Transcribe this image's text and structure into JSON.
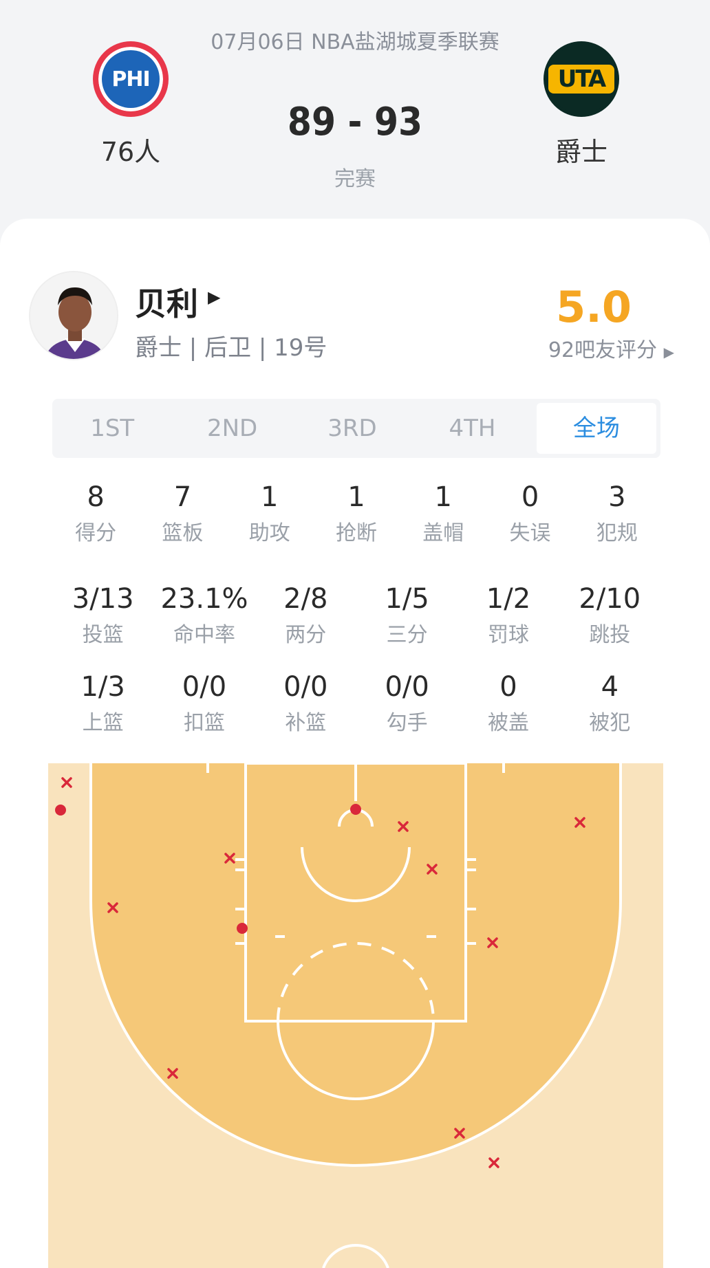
{
  "header": {
    "match_title": "07月06日 NBA盐湖城夏季联赛",
    "score": "89 - 93",
    "status": "完赛",
    "home_team": {
      "abbr": "PHI",
      "name": "76人"
    },
    "away_team": {
      "abbr": "UTA",
      "name": "爵士"
    }
  },
  "player": {
    "name": "贝利",
    "meta": "爵士 | 后卫 | 19号",
    "rating": "5.0",
    "rating_label": "92吧友评分"
  },
  "tabs": [
    "1ST",
    "2ND",
    "3RD",
    "4TH",
    "全场"
  ],
  "active_tab": "全场",
  "basic_stats": [
    {
      "value": "8",
      "label": "得分"
    },
    {
      "value": "7",
      "label": "篮板"
    },
    {
      "value": "1",
      "label": "助攻"
    },
    {
      "value": "1",
      "label": "抢断"
    },
    {
      "value": "1",
      "label": "盖帽"
    },
    {
      "value": "0",
      "label": "失误"
    },
    {
      "value": "3",
      "label": "犯规"
    }
  ],
  "shooting_stats": [
    {
      "value": "3/13",
      "label": "投篮"
    },
    {
      "value": "23.1%",
      "label": "命中率"
    },
    {
      "value": "2/8",
      "label": "两分"
    },
    {
      "value": "1/5",
      "label": "三分"
    },
    {
      "value": "1/2",
      "label": "罚球"
    },
    {
      "value": "2/10",
      "label": "跳投"
    },
    {
      "value": "1/3",
      "label": "上篮"
    },
    {
      "value": "0/0",
      "label": "扣篮"
    },
    {
      "value": "0/0",
      "label": "补篮"
    },
    {
      "value": "0/0",
      "label": "勾手"
    },
    {
      "value": "0",
      "label": "被盖"
    },
    {
      "value": "4",
      "label": "被犯"
    }
  ],
  "colors": {
    "rating": "#f5a623",
    "active_tab": "#2b8de0",
    "court_inside": "#f5c878",
    "court_outside": "#f9e3bd",
    "made": "#d9283a",
    "missed": "#d9283a"
  }
}
